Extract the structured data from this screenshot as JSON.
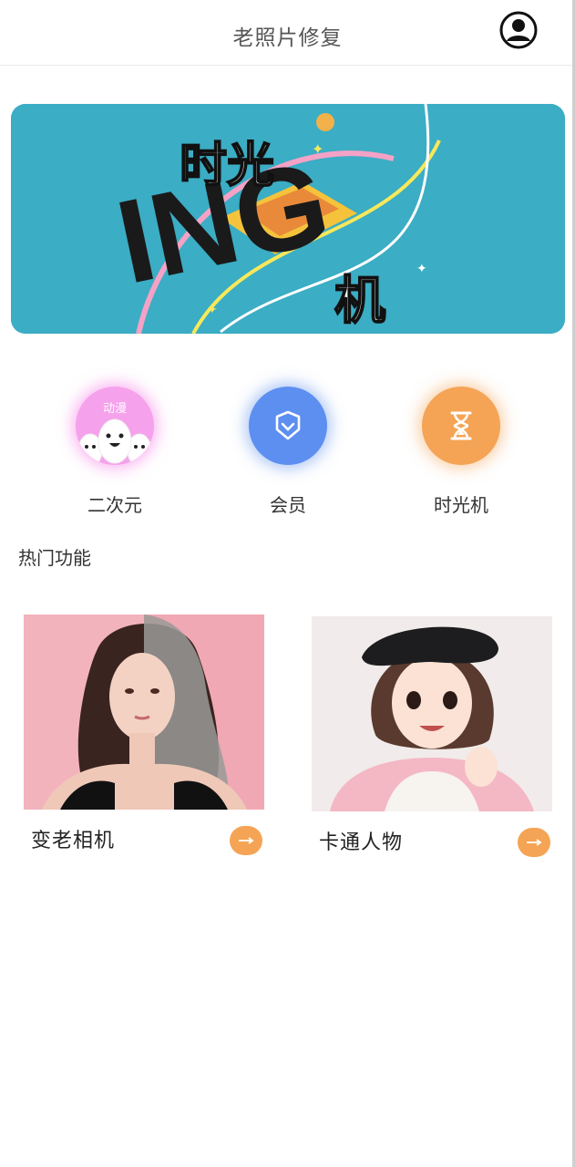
{
  "header": {
    "title": "老照片修复",
    "profile_icon": "user-icon"
  },
  "banner": {
    "big_letters": "ING",
    "text_line1": "时光",
    "text_line2": "机",
    "bg_color": "#3badc4"
  },
  "quick_actions": [
    {
      "label": "二次元",
      "icon": "anime-faces-icon",
      "icon_text": "动漫",
      "color": "#f6a1ec"
    },
    {
      "label": "会员",
      "icon": "shield-check-icon",
      "color": "#5d8ff0"
    },
    {
      "label": "时光机",
      "icon": "hourglass-icon",
      "color": "#f5a455"
    }
  ],
  "section": {
    "title": "热门功能"
  },
  "cards": [
    {
      "title": "变老相机",
      "image": "woman-portrait-half-aged",
      "action_icon": "arrow-right-icon"
    },
    {
      "title": "卡通人物",
      "image": "cartoon-girl-beret",
      "action_icon": "arrow-right-icon"
    }
  ],
  "accent_color": "#f5a455"
}
